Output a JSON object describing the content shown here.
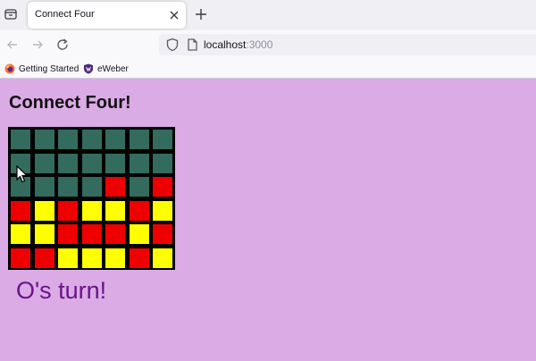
{
  "browser": {
    "tab": {
      "title": "Connect Four"
    },
    "url": {
      "host": "localhost",
      "port": ":3000"
    },
    "bookmarks": [
      {
        "label": "Getting Started",
        "icon": "firefox-icon"
      },
      {
        "label": "eWeber",
        "icon": "shield-crest-icon"
      }
    ]
  },
  "page": {
    "heading": "Connect Four!",
    "status": "O's turn!",
    "colors": {
      "background": "#dbabe6",
      "empty": "#336b5f",
      "red": "#ee0000",
      "yellow": "#ffff00",
      "status_text": "#6a1388"
    }
  },
  "board": {
    "columns": 7,
    "rows": [
      [
        "empty",
        "empty",
        "empty",
        "empty",
        "empty",
        "empty",
        "empty"
      ],
      [
        "empty",
        "empty",
        "empty",
        "empty",
        "empty",
        "empty",
        "empty"
      ],
      [
        "empty",
        "empty",
        "empty",
        "empty",
        "red",
        "empty",
        "red"
      ],
      [
        "red",
        "yellow",
        "red",
        "yellow",
        "yellow",
        "red",
        "yellow"
      ],
      [
        "yellow",
        "yellow",
        "red",
        "red",
        "red",
        "yellow",
        "red"
      ],
      [
        "red",
        "red",
        "yellow",
        "yellow",
        "yellow",
        "red",
        "yellow"
      ]
    ]
  }
}
